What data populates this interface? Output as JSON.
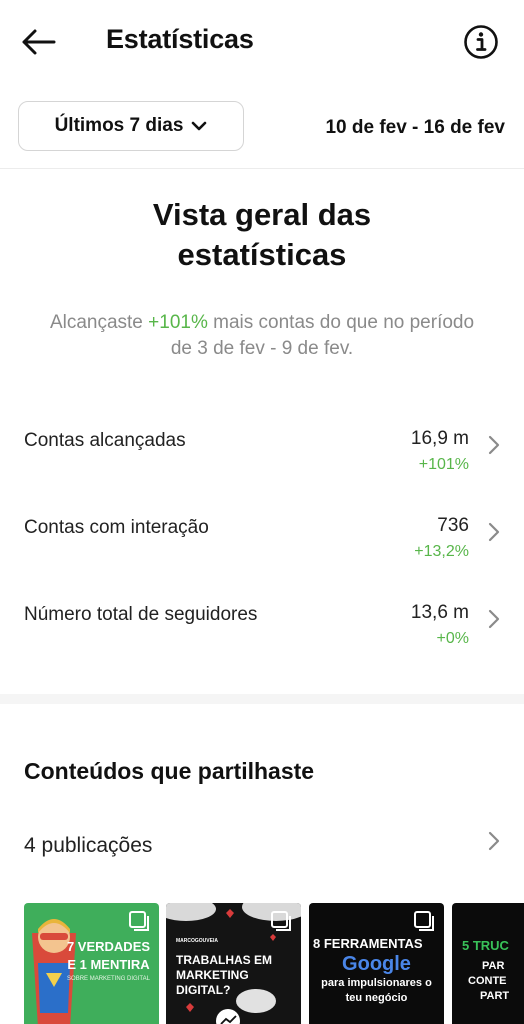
{
  "header": {
    "title": "Estatísticas",
    "back_icon": "arrow-left-icon",
    "info_icon": "info-circle-icon"
  },
  "filter": {
    "range_label": "Últimos 7 dias",
    "date_range": "10 de fev - 16 de fev"
  },
  "overview": {
    "title_line1": "Vista geral das",
    "title_line2": "estatísticas",
    "sub_prefix": "Alcançaste ",
    "sub_highlight": "+101%",
    "sub_suffix": " mais contas do que no período de 3 de fev - 9 de fev."
  },
  "stats": [
    {
      "label": "Contas alcançadas",
      "value": "16,9 m",
      "delta": "+101%"
    },
    {
      "label": "Contas com interação",
      "value": "736",
      "delta": "+13,2%"
    },
    {
      "label": "Número total de seguidores",
      "value": "13,6 m",
      "delta": "+0%"
    }
  ],
  "content": {
    "title": "Conteúdos que partilhaste",
    "posts_count": "4 publicações"
  },
  "thumbnails": [
    {
      "line1": "7 VERDADES",
      "line2": "E 1 MENTIRA",
      "line3": "SOBRE MARKETING DIGITAL"
    },
    {
      "brand": "MARCOGOUVEIA",
      "line1": "TRABALHAS EM",
      "line2": "MARKETING",
      "line3": "DIGITAL?"
    },
    {
      "line1": "8 FERRAMENTAS",
      "brand": "Google",
      "line2": "para impulsionares o",
      "line3": "teu negócio"
    },
    {
      "line1": "5 TRUC",
      "line2": "PAR",
      "line3": "CONTE",
      "line4": "PART"
    }
  ],
  "colors": {
    "accent_green": "#58b64a",
    "muted_text": "#8a8a8a",
    "border": "#d5d5d5"
  }
}
